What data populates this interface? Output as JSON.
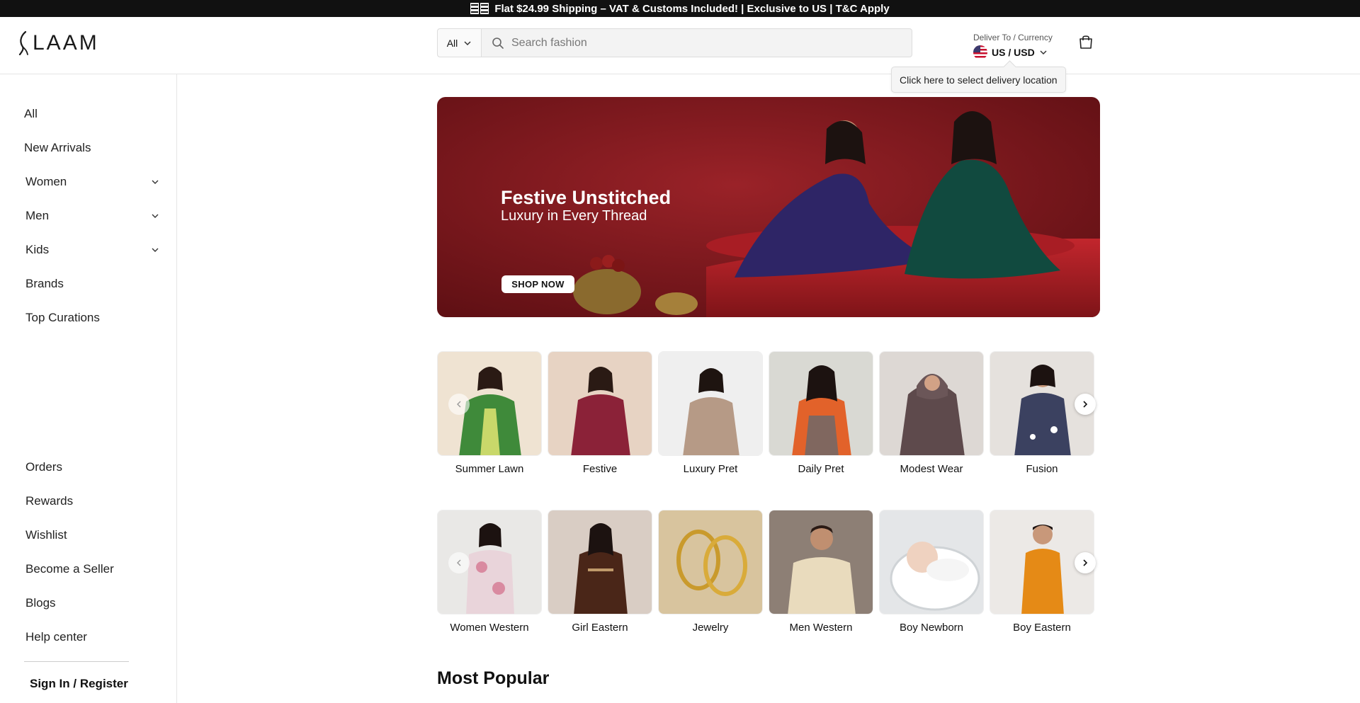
{
  "announcement": {
    "icon": "flag-emoji",
    "text": "Flat $24.99 Shipping – VAT & Customs Included! | Exclusive to US | T&C Apply"
  },
  "header": {
    "logo": "LAAM",
    "search": {
      "scope": "All",
      "placeholder": "Search fashion"
    },
    "deliver": {
      "label": "Deliver To / Currency",
      "value": "US / USD",
      "flag": "us-flag"
    },
    "cart_icon": "shopping-bag-icon"
  },
  "tooltip": "Click here to select delivery location",
  "sidebar": {
    "items": [
      {
        "label": "All",
        "expandable": false
      },
      {
        "label": "New Arrivals",
        "expandable": false
      },
      {
        "label": "Women",
        "expandable": true
      },
      {
        "label": "Men",
        "expandable": true
      },
      {
        "label": "Kids",
        "expandable": true
      },
      {
        "label": "Brands",
        "expandable": false
      },
      {
        "label": "Top Curations",
        "expandable": false
      }
    ],
    "bottom_items": [
      "Orders",
      "Rewards",
      "Wishlist",
      "Become a Seller",
      "Blogs",
      "Help center"
    ],
    "sign_in": "Sign In / Register"
  },
  "hero": {
    "title": "Festive Unstitched",
    "subtitle": "Luxury in Every Thread",
    "button": "SHOP NOW"
  },
  "categories_row1": [
    "Summer Lawn",
    "Festive",
    "Luxury Pret",
    "Daily Pret",
    "Modest Wear",
    "Fusion"
  ],
  "categories_row2": [
    "Women Western",
    "Girl Eastern",
    "Jewelry",
    "Men Western",
    "Boy Newborn",
    "Boy Eastern"
  ],
  "section": {
    "title": "Most Popular"
  },
  "colors": {
    "announce_bg": "#111111",
    "hero_bg": "#7a1519"
  }
}
